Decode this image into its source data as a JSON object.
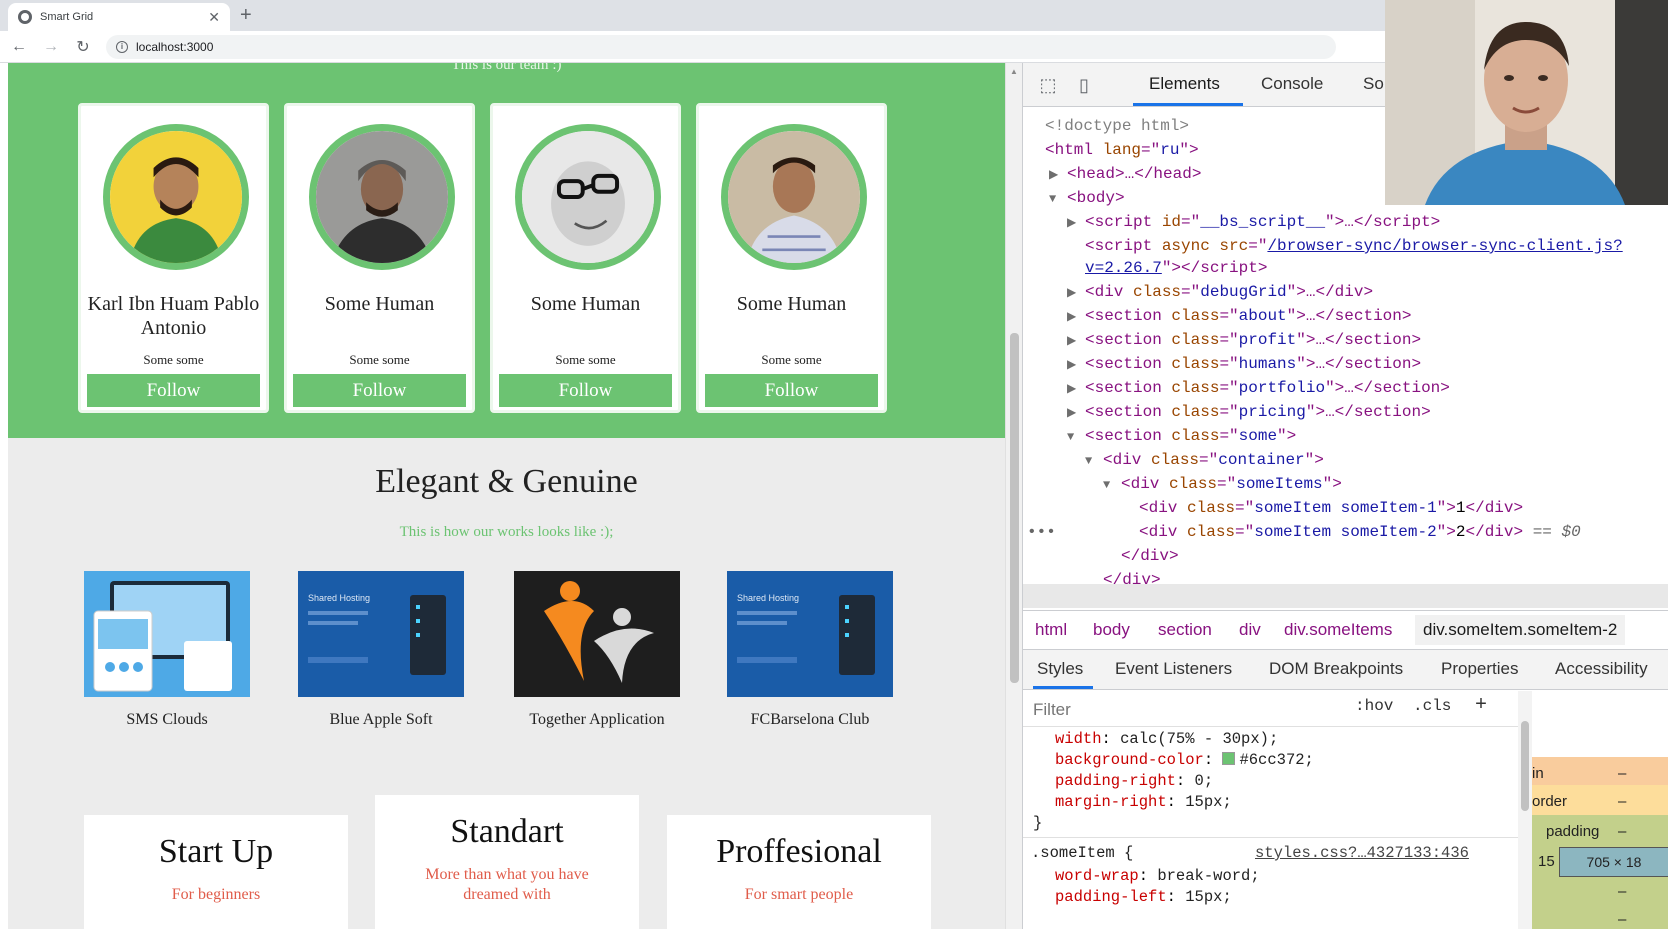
{
  "browser": {
    "tab_title": "Smart Grid",
    "url": "localhost:3000"
  },
  "page": {
    "humans_subtitle": "This is our team :)",
    "team": [
      {
        "name": "Karl Ibn Huam Pablo Antonio",
        "desc": "Some some",
        "button": "Follow"
      },
      {
        "name": "Some Human",
        "desc": "Some some",
        "button": "Follow"
      },
      {
        "name": "Some Human",
        "desc": "Some some",
        "button": "Follow"
      },
      {
        "name": "Some Human",
        "desc": "Some some",
        "button": "Follow"
      }
    ],
    "portfolio_title": "Elegant & Genuine",
    "portfolio_subtitle": "This is how our works looks like :);",
    "works": [
      {
        "label": "SMS Clouds"
      },
      {
        "label": "Blue Apple Soft",
        "banner": "Shared Hosting"
      },
      {
        "label": "Together Application"
      },
      {
        "label": "FCBarselona Club",
        "banner": "Shared Hosting"
      }
    ],
    "pricing": [
      {
        "name": "Start Up",
        "sub": "For beginners"
      },
      {
        "name": "Standart",
        "sub": "More than what you have dreamed with"
      },
      {
        "name": "Proffesional",
        "sub": "For smart people"
      }
    ]
  },
  "devtools": {
    "tabs": [
      "Elements",
      "Console",
      "So"
    ],
    "dom": {
      "doctype": "<!doctype html>",
      "html_attr": "lang",
      "html_val": "ru",
      "bs_script_id": "__bs_script__",
      "bs_src": "/browser-sync/browser-sync-client.js?",
      "bs_src_cont": "v=2.26.7",
      "classes": [
        "debugGrid",
        "about",
        "profit",
        "humans",
        "portfolio",
        "pricing",
        "some"
      ],
      "container": "container",
      "some_items": "someItems",
      "item1_class": "someItem someItem-1",
      "item1_text": "1",
      "item2_class": "someItem someItem-2",
      "item2_text": "2",
      "selected_marker": "== $0"
    },
    "breadcrumbs": [
      "html",
      "body",
      "section",
      "div",
      "div.someItems",
      "div.someItem.someItem-2"
    ],
    "sub_tabs": [
      "Styles",
      "Event Listeners",
      "DOM Breakpoints",
      "Properties",
      "Accessibility"
    ],
    "filter_placeholder": "Filter",
    "hov": ":hov",
    "cls": ".cls",
    "styles": {
      "rule1": [
        {
          "prop": "width",
          "val": "calc(75% - 30px);"
        },
        {
          "prop": "background-color",
          "val": "#6cc372;"
        },
        {
          "prop": "padding-right",
          "val": "0;"
        },
        {
          "prop": "margin-right",
          "val": "15px;"
        }
      ],
      "selector2": ".someItem {",
      "source2": "styles.css?…4327133:436",
      "rule2": [
        {
          "prop": "word-wrap",
          "val": "break-word;"
        },
        {
          "prop": "padding-left",
          "val": "15px;"
        }
      ]
    },
    "boxmodel": {
      "margin": "in",
      "border": "order",
      "padding": "padding",
      "dash": "–",
      "left_padding": "15",
      "content": "705 × 18"
    },
    "swatch_color": "#6cc372"
  }
}
